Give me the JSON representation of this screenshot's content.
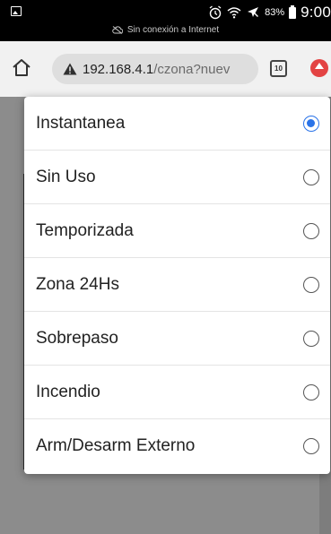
{
  "status_bar": {
    "battery_percent": "83%",
    "time": "9:00",
    "connection_text": "Sin conexión a Internet",
    "icons": [
      "image-icon",
      "alarm-icon",
      "wifi-icon",
      "airplane-icon",
      "battery-icon"
    ]
  },
  "browser": {
    "url_host": "192.168.4.1",
    "url_path": "/czona?nuev",
    "tab_count": "10",
    "security_icon": "warning-triangle-icon",
    "home_icon": "home-icon"
  },
  "dialog": {
    "options": [
      {
        "label": "Instantanea",
        "selected": true
      },
      {
        "label": "Sin Uso",
        "selected": false
      },
      {
        "label": "Temporizada",
        "selected": false
      },
      {
        "label": "Zona 24Hs",
        "selected": false
      },
      {
        "label": "Sobrepaso",
        "selected": false
      },
      {
        "label": "Incendio",
        "selected": false
      },
      {
        "label": "Arm/Desarm Externo",
        "selected": false
      }
    ],
    "accent_color": "#2a73e8"
  }
}
